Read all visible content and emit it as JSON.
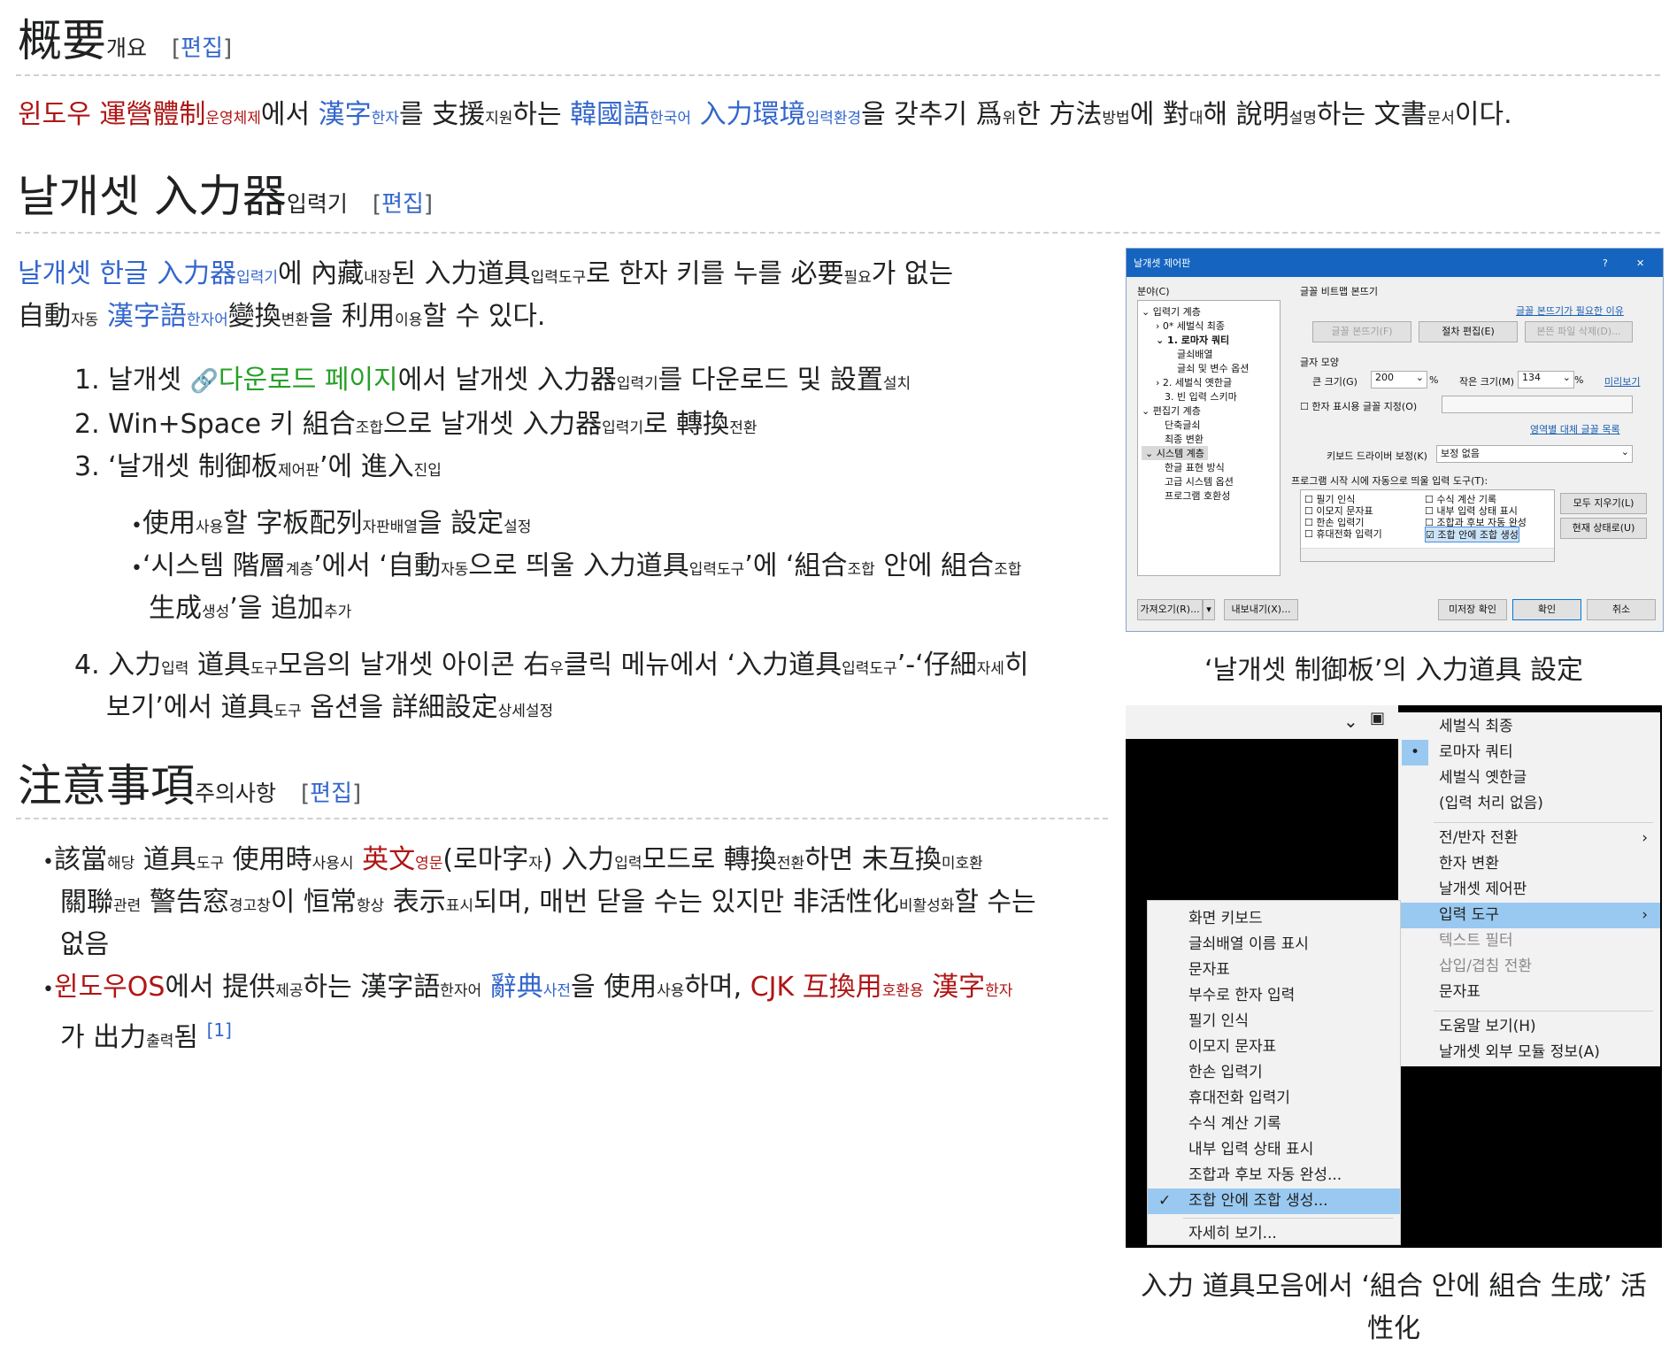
{
  "sections": {
    "overview": {
      "title": "概要",
      "title_small": "개요",
      "edit": "편집"
    },
    "nalgaeset": {
      "title": "날개셋 入力器",
      "title_small": "입력기",
      "edit": "편집"
    },
    "cautions": {
      "title": "注意事項",
      "title_small": "주의사항",
      "edit": "편집"
    }
  },
  "overview_para": {
    "p1": "윈도우 運營體制",
    "p1s": "운영체제",
    "p2": "에서 ",
    "p3": "漢字",
    "p3s": "한자",
    "p4": "를 支援",
    "p4s": "지원",
    "p5": "하는 ",
    "p6": "韓國語",
    "p6s": "한국어",
    "p7": " ",
    "p8": "入力環境",
    "p8s": "입력환경",
    "p9": "을 갖추기 爲",
    "p9s": "위",
    "p10": "한 方法",
    "p10s": "방법",
    "p11": "에 對",
    "p11s": "대",
    "p12": "해 說明",
    "p12s": "설명",
    "p13": "하는 文書",
    "p13s": "문서",
    "p14": "이다."
  },
  "intro": {
    "a1": "날개셋 한글 入力器",
    "a1s": "입력기",
    "a2": "에 內藏",
    "a2s": "내장",
    "a3": "된 入力道具",
    "a3s": "입력도구",
    "a4": "로 한자 키를 누를 必要",
    "a4s": "필요",
    "a5": "가 없는",
    "b1": "自動",
    "b1s": "자동",
    "b2": " ",
    "b3": "漢字語",
    "b3s": "한자어",
    "b4": "變換",
    "b4s": "변환",
    "b5": "을 利用",
    "b5s": "이용",
    "b6": "할 수 있다."
  },
  "steps": {
    "s1": {
      "num": "1.",
      "a": "날개셋 ",
      "link": "다운로드 페이지",
      "b": "에서 날개셋 入力器",
      "bs": "입력기",
      "c": "를 다운로드 및 設置",
      "cs": "설치"
    },
    "s2": {
      "num": "2.",
      "a": "Win+Space 키 組合",
      "as": "조합",
      "b": "으로 날개셋 入力器",
      "bs": "입력기",
      "c": "로 轉換",
      "cs": "전환"
    },
    "s3": {
      "num": "3.",
      "a": "‘날개셋 制御板",
      "as": "제어판",
      "b": "’에 進入",
      "bs": "진입"
    },
    "s3a": {
      "a": "使用",
      "as": "사용",
      "b": "할 字板配列",
      "bs": "자판배열",
      "c": "을 設定",
      "cs": "설정"
    },
    "s3b": {
      "a": "‘시스템 階層",
      "as": "계층",
      "b": "’에서 ‘自動",
      "bs": "자동",
      "c": "으로 띄울 入力道具",
      "cs": "입력도구",
      "d": "’에 ‘組合",
      "ds": "조합",
      "e": " 안에 組合",
      "es": "조합",
      "f": "生成",
      "fs": "생성",
      "g": "’을 追加",
      "gs": "추가"
    },
    "s4": {
      "num": "4.",
      "a": "入力",
      "as": "입력",
      "b": " 道具",
      "bs": "도구",
      "c": "모음의 날개셋 아이콘 右",
      "cs": "우",
      "d": "클릭 메뉴에서 ‘入力道具",
      "ds": "입력도구",
      "e": "’-‘仔細",
      "es": "자세",
      "f": "히",
      "g": "보기’에서 道具",
      "gs": "도구",
      "h": " 옵션을 詳細設定",
      "hs": "상세설정"
    }
  },
  "cautions": {
    "c1": {
      "a": "該當",
      "as": "해당",
      "b": " 道具",
      "bs": "도구",
      "c": " 使用時",
      "cs": "사용시",
      "d": " ",
      "red": "英文",
      "reds": "영문",
      "e": "(로마字",
      "es": "자",
      "f": ") 入力",
      "fs": "입력",
      "g": "모드로 轉換",
      "gs": "전환",
      "h": "하면 未互換",
      "hs": "미호환",
      "i": "關聯",
      "is": "관련",
      "j": " 警告窓",
      "js": "경고창",
      "k": "이 恒常",
      "ks": "항상",
      "l": " 表示",
      "ls": "표시",
      "m": "되며, 매번 닫을 수는 있지만 非活性化",
      "ms": "비활성화",
      "n": "할 수는",
      "o": "없음"
    },
    "c2": {
      "red1": "윈도우OS",
      "a": "에서 提供",
      "as": "제공",
      "b": "하는 漢字語",
      "bs": "한자어",
      "c": " ",
      "lk": "辭典",
      "lks": "사전",
      "d": "을 使用",
      "ds": "사용",
      "e": "하며, ",
      "red2": "CJK 互換用",
      "red2s": "호환용",
      "f": " ",
      "red3": "漢字",
      "red3s": "한자",
      "g": "가 出力",
      "gs": "출력",
      "h": "됨 ",
      "ref": "[1]"
    }
  },
  "captions": {
    "c1": "‘날개셋 制御板’의 入力道具 設定",
    "c2a": "入力 道具모음에서 ‘組合 안에 組合 生成’ 活",
    "c2b": "性化"
  },
  "dialog": {
    "title": "날개셋 제어판",
    "help": "?",
    "close": "✕",
    "category_label": "분야(C)",
    "tree": [
      "입력기 계층",
      "0* 세벌식 최종",
      "1. 로마자 쿼티",
      "글쇠배열",
      "글쇠 및 변수 옵션",
      "2. 세벌식 옛한글",
      "3. 빈 입력 스키마",
      "편집기 계층",
      "단축글쇠",
      "최종 변환",
      "시스템 계층",
      "한글 표현 방식",
      "고급 시스템 옵션",
      "프로그램 호환성"
    ],
    "bitmap_group": "글꼴 비트맵 본뜨기",
    "bitmap_link": "글꼴 본뜨기가 필요한 이유",
    "btn_bitmap": "글꼴 본뜨기(F)",
    "btn_proc_edit": "절차 편집(E)",
    "btn_delete": "본뜬 파일 삭제(D)...",
    "shape_group": "글자 모양",
    "large_label": "큰 크기(G)",
    "large_value": "200",
    "small_label": "작은 크기(M)",
    "small_value": "134",
    "pct": "%",
    "preview_link": "미리보기",
    "hanja_font": "한자 표시용 글꼴 지정(O)",
    "per_region_link": "영역별 대체 글꼴 목록",
    "kb_driver_label": "키보드 드라이버 보정(K)",
    "kb_driver_value": "보정 없음",
    "auto_tools_label": "프로그램 시작 시에 자동으로 띄울 입력 도구(T):",
    "tools_left": [
      "필기 인식",
      "이모지 문자표",
      "한손 입력기",
      "휴대전화 입력기"
    ],
    "tools_right": [
      "수식 계산 기록",
      "내부 입력 상태 표시",
      "조합과 후보 자동 완성",
      "조합 안에 조합 생성"
    ],
    "btn_clear_all": "모두 지우기(L)",
    "btn_current": "현재 상태로(U)",
    "btn_import": "가져오기(R)...",
    "btn_export": "내보내기(X)...",
    "btn_unsaved": "미저장 확인",
    "btn_ok": "확인",
    "btn_cancel": "취소"
  },
  "menu_right": [
    {
      "label": "세벌식 최종"
    },
    {
      "label": "로마자 쿼티",
      "bullet": "•"
    },
    {
      "label": "세벌식 옛한글"
    },
    {
      "label": "(입력 처리 없음)"
    },
    {
      "label": "전/반자 전환",
      "arrow": "›"
    },
    {
      "label": "한자 변환"
    },
    {
      "label": "날개셋 제어판"
    },
    {
      "label": "입력 도구",
      "arrow": "›"
    },
    {
      "label": "텍스트 필터"
    },
    {
      "label": "삽입/겹침 전환"
    },
    {
      "label": "문자표"
    },
    {
      "label": "도움말 보기(H)"
    },
    {
      "label": "날개셋 외부 모듈 정보(A)"
    }
  ],
  "menu_left": [
    {
      "label": "화면 키보드"
    },
    {
      "label": "글쇠배열 이름 표시"
    },
    {
      "label": "문자표"
    },
    {
      "label": "부수로 한자 입력"
    },
    {
      "label": "필기 인식"
    },
    {
      "label": "이모지 문자표"
    },
    {
      "label": "한손 입력기"
    },
    {
      "label": "휴대전화 입력기"
    },
    {
      "label": "수식 계산 기록"
    },
    {
      "label": "내부 입력 상태 표시"
    },
    {
      "label": "조합과 후보 자동 완성..."
    },
    {
      "label": "조합 안에 조합 생성...",
      "check": "✓"
    },
    {
      "label": "자세히 보기..."
    }
  ],
  "colors": {
    "link": "#3366cc",
    "red": "#b01515",
    "green": "#26a026",
    "highlight": "#99c9f1",
    "titlebar": "#1565c0"
  }
}
